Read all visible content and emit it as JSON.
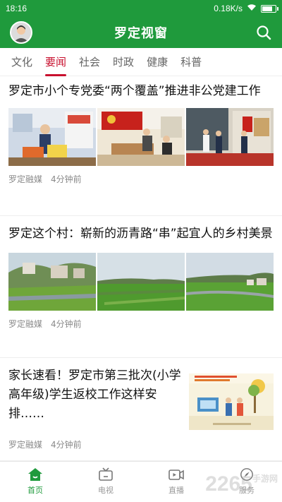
{
  "status": {
    "time": "18:16",
    "speed": "0.18K/s",
    "battery_level": 0.8
  },
  "header": {
    "title": "罗定视窗"
  },
  "tabs": [
    {
      "label": "文化",
      "active": false
    },
    {
      "label": "要闻",
      "active": true
    },
    {
      "label": "社会",
      "active": false
    },
    {
      "label": "时政",
      "active": false
    },
    {
      "label": "健康",
      "active": false
    },
    {
      "label": "科普",
      "active": false
    }
  ],
  "articles": [
    {
      "title": "罗定市小个专党委“两个覆盖”推进非公党建工作",
      "source": "罗定融媒",
      "time": "4分钟前"
    },
    {
      "title": "罗定这个村：崭新的沥青路“串”起宜人的乡村美景",
      "source": "罗定融媒",
      "time": "4分钟前"
    },
    {
      "title": "家长速看！罗定市第三批次(小学高年级)学生返校工作这样安排……",
      "source": "罗定融媒",
      "time": "4分钟前"
    }
  ],
  "nav": [
    {
      "label": "首页",
      "icon": "home-icon",
      "active": true
    },
    {
      "label": "电视",
      "icon": "tv-icon",
      "active": false
    },
    {
      "label": "直播",
      "icon": "live-icon",
      "active": false
    },
    {
      "label": "服务",
      "icon": "compass-icon",
      "active": false
    }
  ],
  "watermark": {
    "big": "2265",
    "small": "手游网"
  },
  "colors": {
    "brand_green": "#1f9a3c",
    "accent_red": "#c8102e"
  }
}
